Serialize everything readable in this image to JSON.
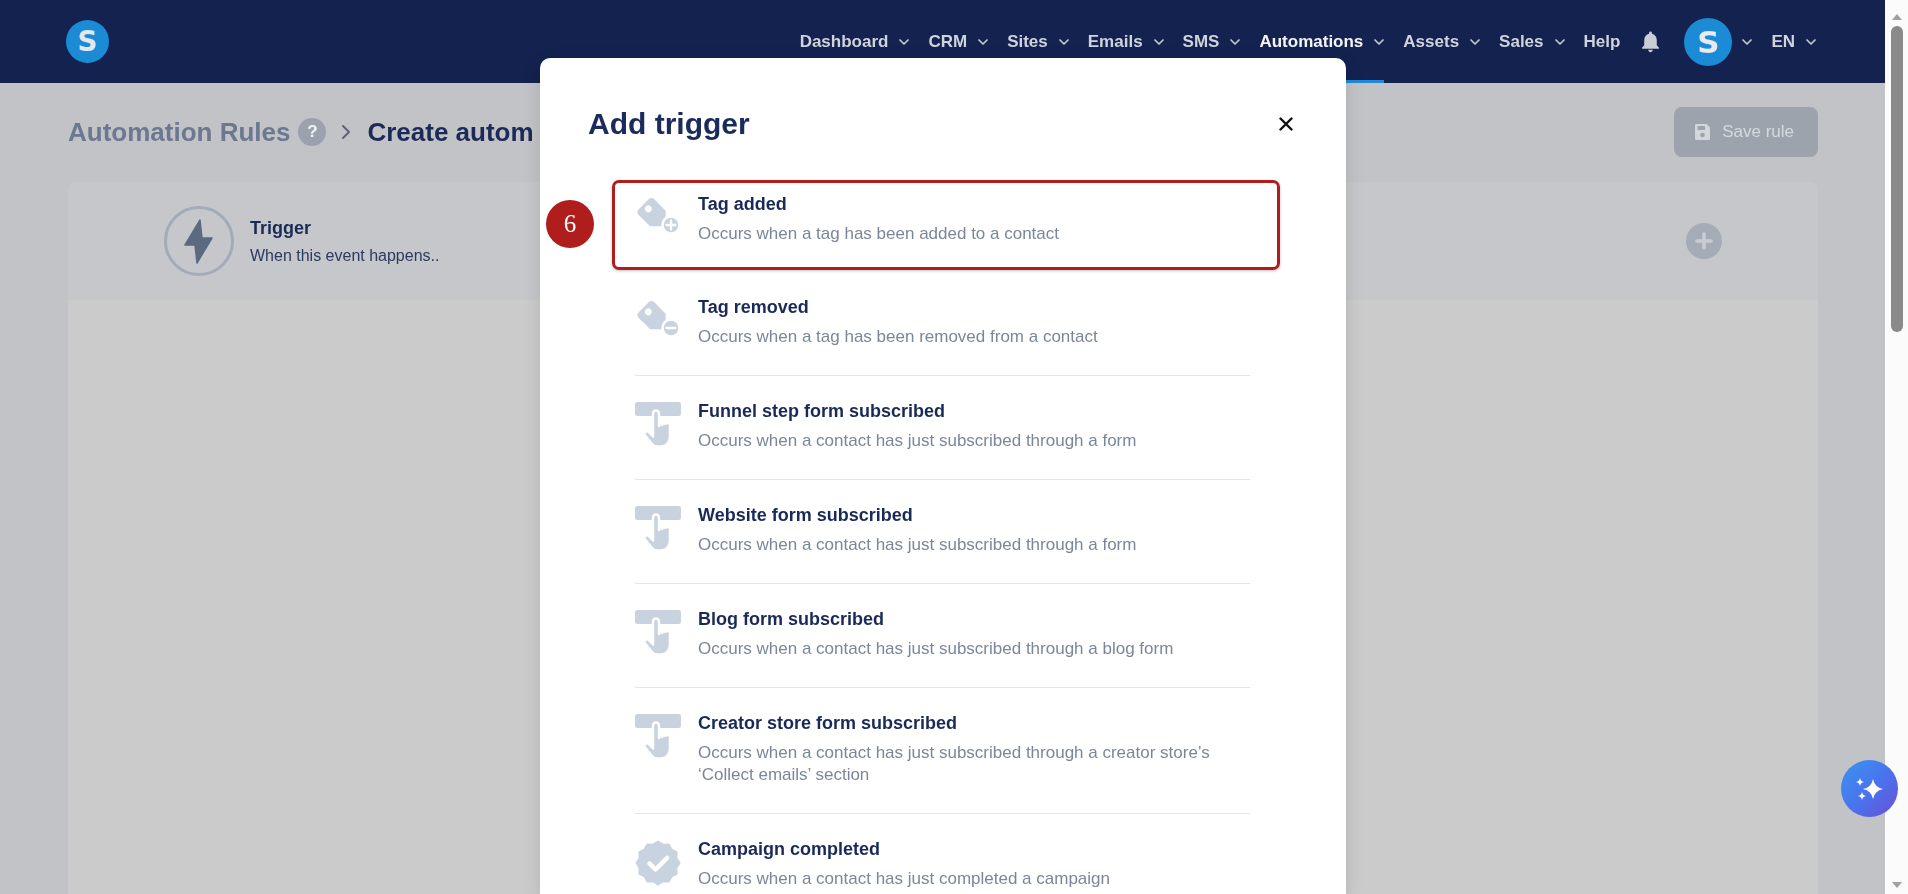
{
  "nav": {
    "logo": "S",
    "items": [
      {
        "label": "Dashboard",
        "dropdown": true,
        "selected": false
      },
      {
        "label": "CRM",
        "dropdown": true,
        "selected": false
      },
      {
        "label": "Sites",
        "dropdown": true,
        "selected": false
      },
      {
        "label": "Emails",
        "dropdown": true,
        "selected": false
      },
      {
        "label": "SMS",
        "dropdown": true,
        "selected": false
      },
      {
        "label": "Automations",
        "dropdown": true,
        "selected": true
      },
      {
        "label": "Assets",
        "dropdown": true,
        "selected": false
      },
      {
        "label": "Sales",
        "dropdown": true,
        "selected": false
      },
      {
        "label": "Help",
        "dropdown": false,
        "selected": false
      }
    ],
    "avatar": {
      "letter": "S",
      "dropdown": true
    },
    "language": {
      "label": "EN",
      "dropdown": true
    }
  },
  "header": {
    "parent": "Automation Rules",
    "help": "?",
    "current": "Create autom",
    "save_label": "Save rule"
  },
  "trigger_card": {
    "title": "Trigger",
    "subtitle": "When this event happens.."
  },
  "modal": {
    "title": "Add trigger",
    "step_badge": "6",
    "items": [
      {
        "kind": "tag_add",
        "title": "Tag added",
        "description": "Occurs when a tag has been added to a contact",
        "highlighted": true
      },
      {
        "kind": "tag_remove",
        "title": "Tag removed",
        "description": "Occurs when a tag has been removed from a contact",
        "highlighted": false
      },
      {
        "kind": "form",
        "title": "Funnel step form subscribed",
        "description": "Occurs when a contact has just subscribed through a form",
        "highlighted": false
      },
      {
        "kind": "form",
        "title": "Website form subscribed",
        "description": "Occurs when a contact has just subscribed through a form",
        "highlighted": false
      },
      {
        "kind": "form",
        "title": "Blog form subscribed",
        "description": "Occurs when a contact has just subscribed through a blog form",
        "highlighted": false
      },
      {
        "kind": "form",
        "title": "Creator store form subscribed",
        "description": "Occurs when a contact has just subscribed through a creator store’s ‘Collect emails’ section",
        "highlighted": false
      },
      {
        "kind": "badge",
        "title": "Campaign completed",
        "description": "Occurs when a contact has just completed a campaign",
        "highlighted": false
      }
    ]
  }
}
